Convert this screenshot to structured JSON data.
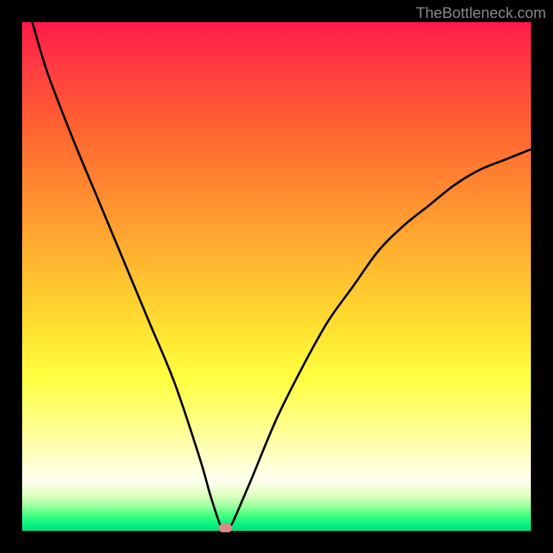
{
  "watermark": "TheBottleneck.com",
  "chart_data": {
    "type": "line",
    "title": "",
    "xlabel": "",
    "ylabel": "",
    "xlim": [
      0,
      100
    ],
    "ylim": [
      0,
      100
    ],
    "grid": false,
    "legend": false,
    "background_gradient": {
      "top": "#ff1a4a",
      "middle": "#ffe030",
      "bottom": "#00dd80"
    },
    "series": [
      {
        "name": "bottleneck-curve",
        "color": "#000000",
        "x": [
          2,
          5,
          10,
          15,
          20,
          25,
          30,
          35,
          37,
          39,
          40,
          41,
          42,
          45,
          50,
          55,
          60,
          65,
          70,
          75,
          80,
          85,
          90,
          95,
          100
        ],
        "y": [
          100,
          90,
          77,
          65,
          53,
          41,
          29,
          14,
          7,
          1,
          0,
          1,
          3,
          10,
          22,
          32,
          41,
          48,
          55,
          60,
          64,
          68,
          71,
          73,
          75
        ]
      }
    ],
    "marker": {
      "x": 40,
      "y": 0,
      "color": "#d98a88",
      "shape": "rounded-rect"
    }
  }
}
